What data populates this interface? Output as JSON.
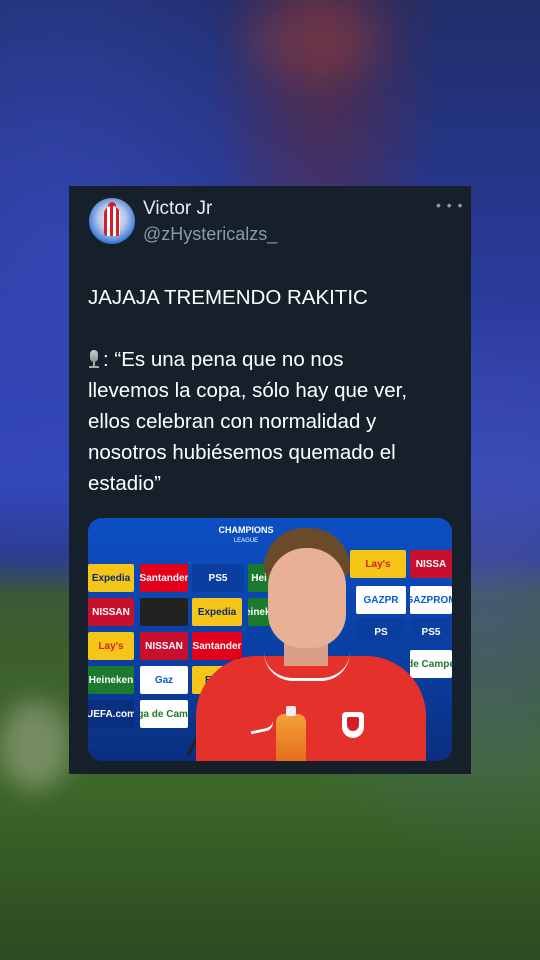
{
  "tweet": {
    "name": "Victor Jr",
    "handle": "@zHystericalzs_",
    "more_icon": "ellipsis-icon",
    "headline": "JAJAJA TREMENDO RAKITIC",
    "quote_line1": ": “Es una pena que no nos",
    "quote_line2": "llevemos la copa, sólo hay que ver,",
    "quote_line3": "ellos celebran con  normalidad y",
    "quote_line4": "nosotros hubiésemos quemado el",
    "quote_line5": "estadio”"
  },
  "photo": {
    "backdrop_title": "CHAMPIONS",
    "backdrop_sub": "LEAGUE",
    "sponsors": [
      {
        "label": "Expedia",
        "bg": "#f5c518",
        "fg": "#0b2a6e"
      },
      {
        "label": "Santander",
        "bg": "#e2001a",
        "fg": "#ffffff"
      },
      {
        "label": "PS5",
        "bg": "#0a3ea0",
        "fg": "#ffffff"
      },
      {
        "label": "Hei",
        "bg": "#1b7a2e",
        "fg": "#ffffff"
      },
      {
        "label": "Lay's",
        "bg": "#f5c518",
        "fg": "#d61e2a"
      },
      {
        "label": "NISSA",
        "bg": "#c8102e",
        "fg": "#ffffff"
      },
      {
        "label": "NISSAN",
        "bg": "#c8102e",
        "fg": "#ffffff"
      },
      {
        "label": "",
        "bg": "#222222",
        "fg": "#ffffff"
      },
      {
        "label": "Expedia",
        "bg": "#f5c518",
        "fg": "#0b2a6e"
      },
      {
        "label": "Heineken",
        "bg": "#1b7a2e",
        "fg": "#ffffff"
      },
      {
        "label": "GAZPR",
        "bg": "#ffffff",
        "fg": "#0a5bd6"
      },
      {
        "label": "GAZPROM",
        "bg": "#ffffff",
        "fg": "#0a5bd6"
      },
      {
        "label": "Lay's",
        "bg": "#f5c518",
        "fg": "#d61e2a"
      },
      {
        "label": "NISSAN",
        "bg": "#c8102e",
        "fg": "#ffffff"
      },
      {
        "label": "Santander",
        "bg": "#e2001a",
        "fg": "#ffffff"
      },
      {
        "label": "PS",
        "bg": "#0a3ea0",
        "fg": "#ffffff"
      },
      {
        "label": "PS5",
        "bg": "#0a3ea0",
        "fg": "#ffffff"
      },
      {
        "label": "Heineken",
        "bg": "#1b7a2e",
        "fg": "#ffffff"
      },
      {
        "label": "Gaz",
        "bg": "#ffffff",
        "fg": "#0a5bd6"
      },
      {
        "label": "Expe",
        "bg": "#f5c518",
        "fg": "#0b2a6e"
      },
      {
        "label": "Liga de Campeones",
        "bg": "#ffffff",
        "fg": "#1b7a2e"
      },
      {
        "label": "UEFA.com",
        "bg": "#0a2f80",
        "fg": "#ffffff"
      },
      {
        "label": "Liga de Campe",
        "bg": "#ffffff",
        "fg": "#1b7a2e"
      }
    ]
  }
}
